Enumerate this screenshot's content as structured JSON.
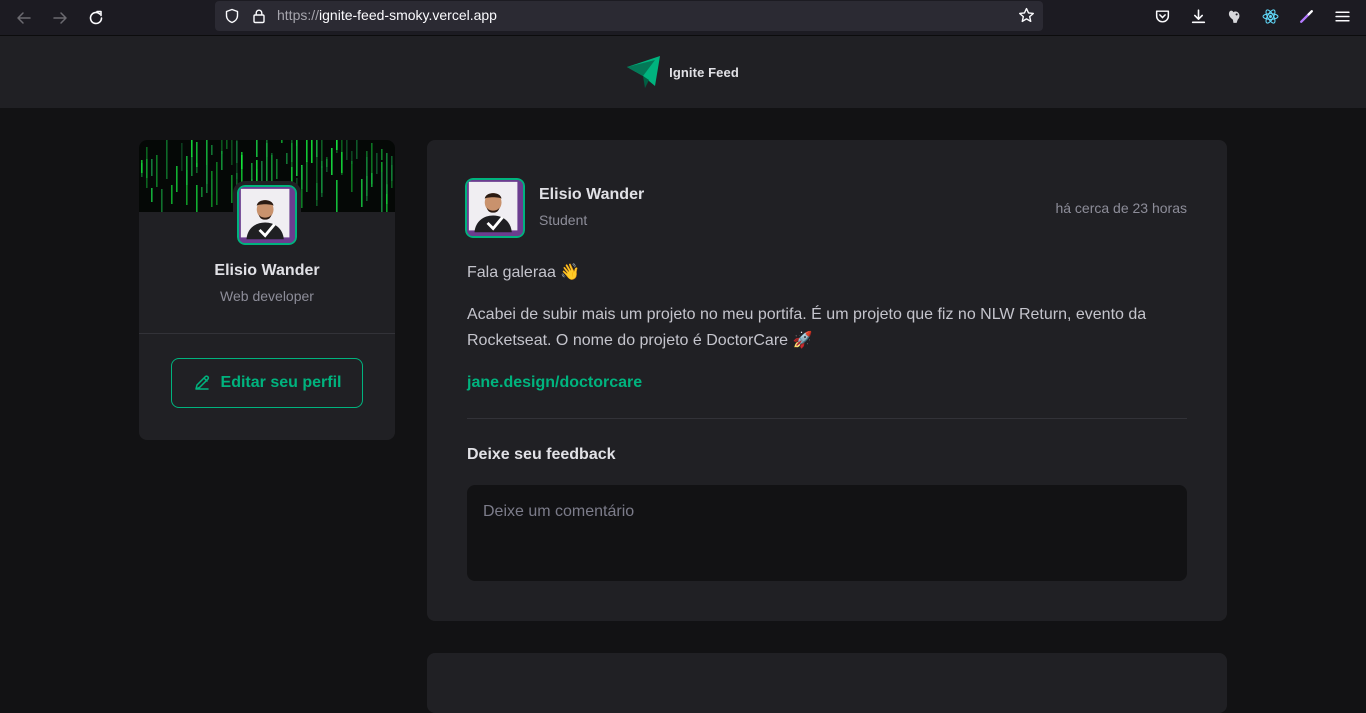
{
  "browser": {
    "url_protocol": "https://",
    "url_host": "ignite-feed-smoky.vercel.app"
  },
  "header": {
    "app_name": "Ignite Feed",
    "brand_color": "#00875f"
  },
  "sidebar": {
    "name": "Elisio Wander",
    "role": "Web developer",
    "edit_label": "Editar seu perfil"
  },
  "post": {
    "author_name": "Elisio Wander",
    "author_role": "Student",
    "time": "há cerca de 23 horas",
    "paragraph_1": "Fala galeraa 👋",
    "paragraph_2": "Acabei de subir mais um projeto no meu portifa. É um projeto que fiz no NLW Return, evento da Rocketseat. O nome do projeto é DoctorCare 🚀",
    "link": "jane.design/doctorcare",
    "feedback_title": "Deixe seu feedback",
    "comment_placeholder": "Deixe um comentário"
  },
  "colors": {
    "accent": "#00b37e",
    "background": "#121214",
    "card": "#202024"
  }
}
